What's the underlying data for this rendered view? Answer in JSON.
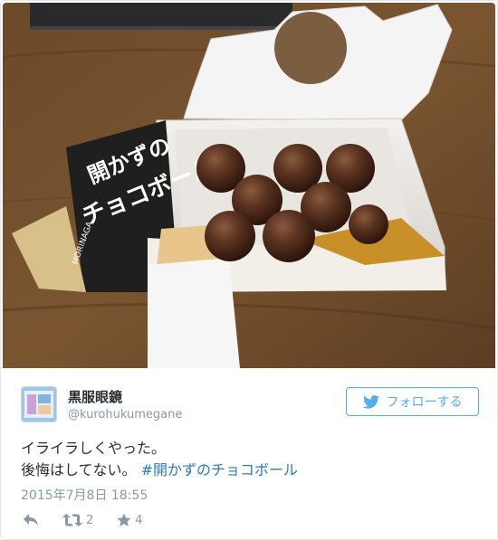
{
  "author": {
    "display_name": "黒服眼鏡",
    "handle": "@kurohukumegane"
  },
  "follow_button": {
    "label": "フォローする",
    "icon": "twitter-bird-icon"
  },
  "tweet": {
    "line1": "イライラしくやった。",
    "line2_text": "後悔はしてない。 ",
    "hashtag": "#開かずのチョコボール",
    "timestamp": "2015年7月8日 18:55"
  },
  "photo": {
    "box_brand": "MORINAGA",
    "box_title_top": "開かずの",
    "box_title_bottom": "チョコボール"
  },
  "actions": {
    "reply_icon": "reply-icon",
    "retweet_icon": "retweet-icon",
    "retweet_count": "2",
    "favorite_icon": "star-icon",
    "favorite_count": "4"
  },
  "colors": {
    "accent": "#55acee",
    "hashtag": "#2b7bb9",
    "muted": "#8899a6",
    "text": "#292f33"
  }
}
